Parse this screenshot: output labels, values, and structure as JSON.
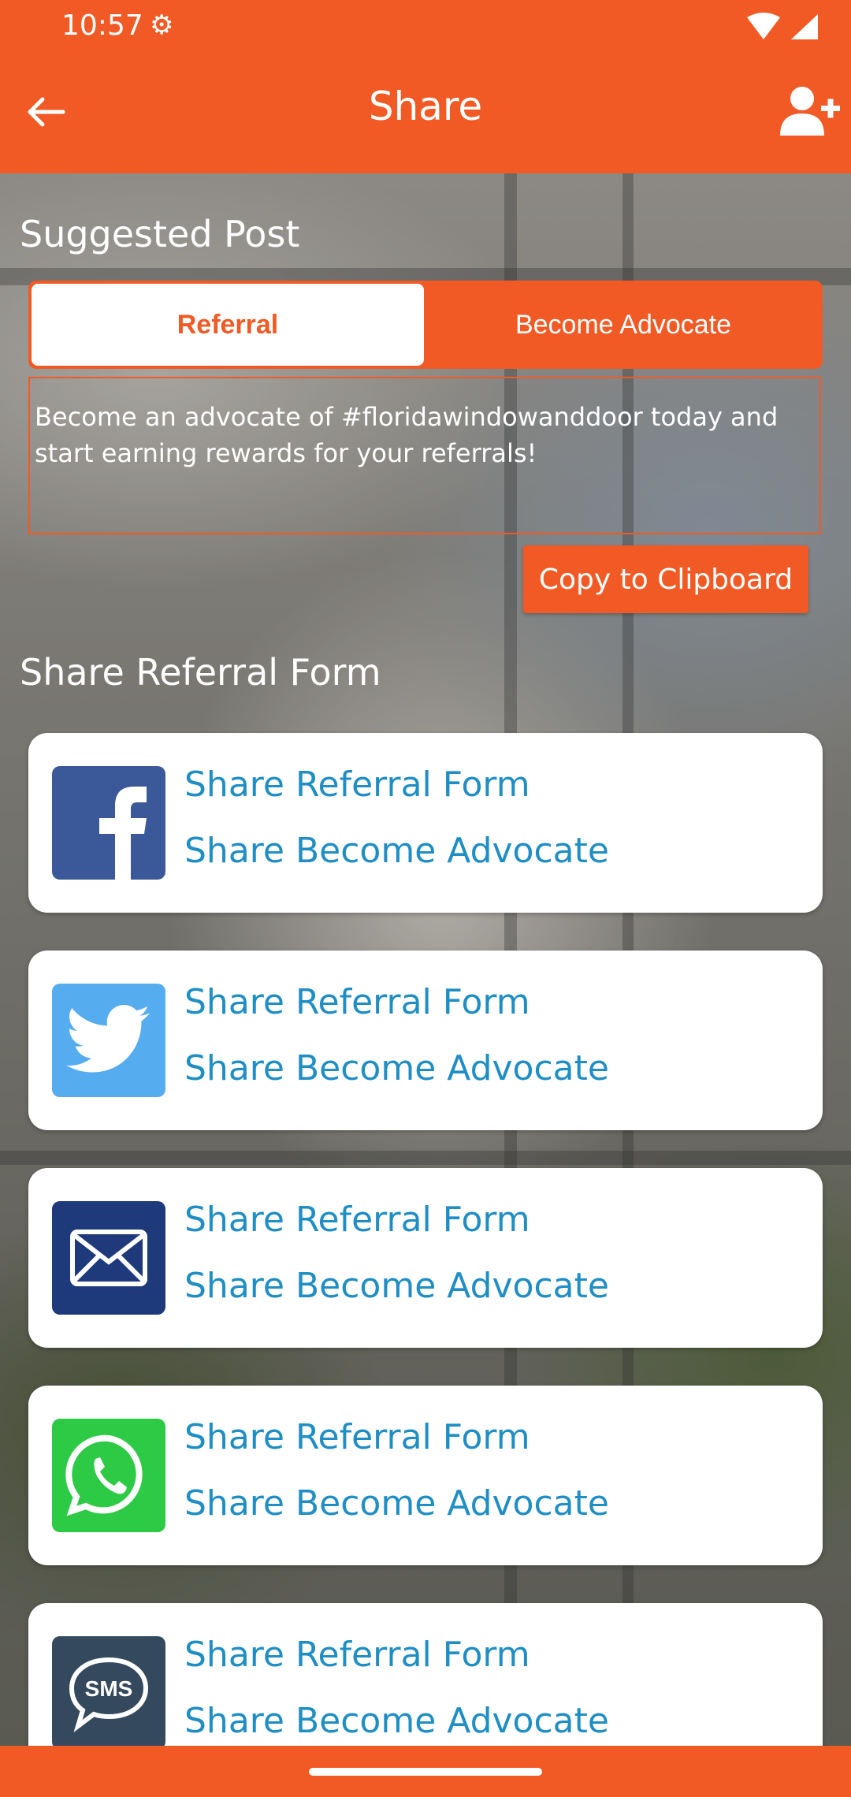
{
  "status_bar": {
    "time": "10:57"
  },
  "header": {
    "title": "Share"
  },
  "suggested_post": {
    "heading": "Suggested Post",
    "tabs": [
      {
        "label": "Referral",
        "active": true
      },
      {
        "label": "Become Advocate",
        "active": false
      }
    ],
    "message": "Become an advocate of #floridawindowanddoor today and start earning rewards for your referrals!",
    "copy_button": "Copy to Clipboard"
  },
  "share_section": {
    "heading": "Share Referral Form",
    "cards": [
      {
        "icon": "facebook-icon",
        "color": "#3b5998",
        "link1": "Share Referral Form",
        "link2": "Share Become Advocate"
      },
      {
        "icon": "twitter-icon",
        "color": "#55acee",
        "link1": "Share Referral Form",
        "link2": "Share Become Advocate"
      },
      {
        "icon": "email-icon",
        "color": "#1e3a7a",
        "link1": "Share Referral Form",
        "link2": "Share Become Advocate"
      },
      {
        "icon": "whatsapp-icon",
        "color": "#2dca45",
        "link1": "Share Referral Form",
        "link2": "Share Become Advocate"
      },
      {
        "icon": "sms-icon",
        "color": "#34495e",
        "icon_text": "SMS",
        "link1": "Share Referral Form",
        "link2": "Share Become Advocate"
      }
    ]
  },
  "colors": {
    "brand": "#f15a24",
    "link": "#1f8ec4"
  }
}
